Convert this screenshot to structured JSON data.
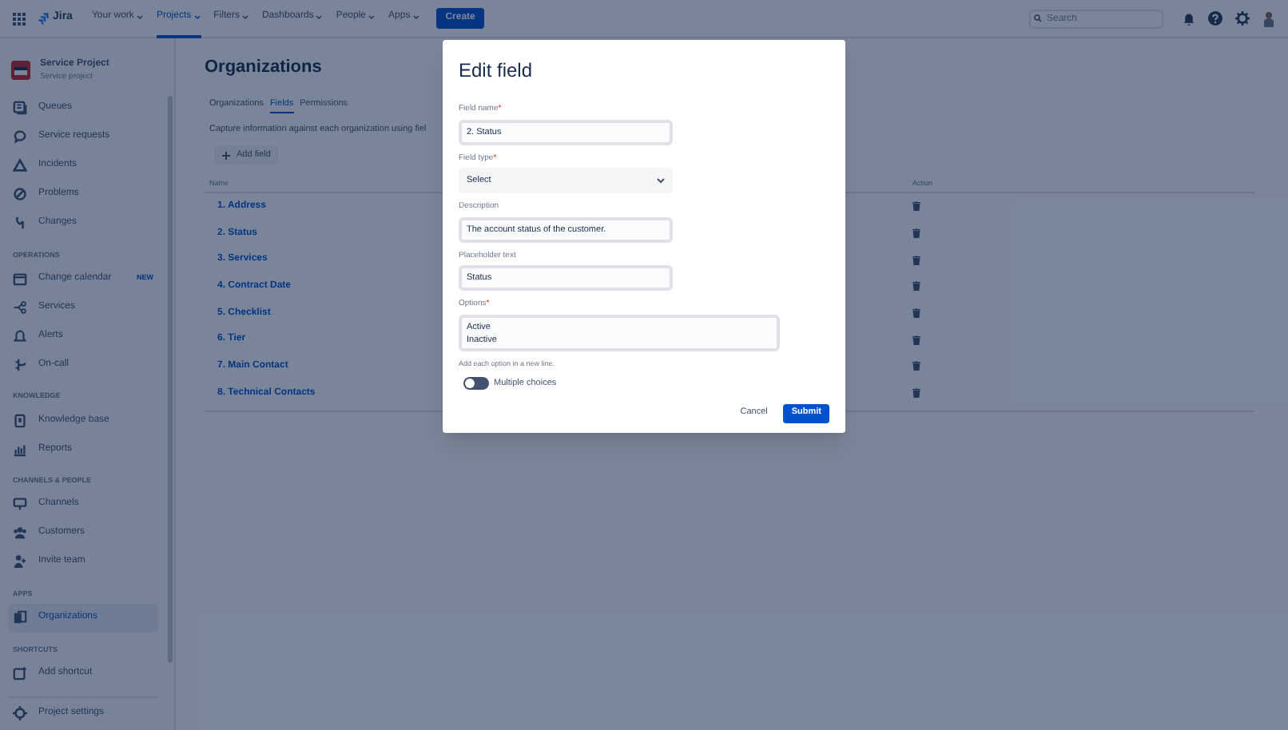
{
  "nav": {
    "logo": "Jira",
    "items": [
      {
        "label": "Your work",
        "selected": false
      },
      {
        "label": "Projects",
        "selected": true
      },
      {
        "label": "Filters",
        "selected": false
      },
      {
        "label": "Dashboards",
        "selected": false
      },
      {
        "label": "People",
        "selected": false
      },
      {
        "label": "Apps",
        "selected": false
      }
    ],
    "create": "Create",
    "search": {
      "placeholder": "Search"
    }
  },
  "sidebar": {
    "project": {
      "name": "Service Project",
      "type": "Service project"
    },
    "sections": [
      {
        "items": [
          {
            "label": "Queues",
            "selected": false
          },
          {
            "label": "Service requests",
            "selected": false
          },
          {
            "label": "Incidents",
            "selected": false
          },
          {
            "label": "Problems",
            "selected": false
          },
          {
            "label": "Changes",
            "selected": false
          }
        ]
      },
      {
        "heading": "OPERATIONS",
        "items": [
          {
            "label": "Change calendar",
            "badge": "NEW",
            "selected": false
          },
          {
            "label": "Services",
            "selected": false
          },
          {
            "label": "Alerts",
            "selected": false
          },
          {
            "label": "On-call",
            "selected": false
          }
        ]
      },
      {
        "heading": "KNOWLEDGE",
        "items": [
          {
            "label": "Knowledge base",
            "selected": false
          },
          {
            "label": "Reports",
            "selected": false
          }
        ]
      },
      {
        "heading": "CHANNELS & PEOPLE",
        "items": [
          {
            "label": "Channels",
            "selected": false
          },
          {
            "label": "Customers",
            "selected": false
          },
          {
            "label": "Invite team",
            "selected": false
          }
        ]
      },
      {
        "heading": "APPS",
        "items": [
          {
            "label": "Organizations",
            "selected": true
          }
        ]
      },
      {
        "heading": "SHORTCUTS",
        "items": [
          {
            "label": "Add shortcut",
            "selected": false
          }
        ]
      }
    ],
    "footer": "Project settings"
  },
  "main": {
    "title": "Organizations",
    "tabs": [
      {
        "label": "Organizations",
        "selected": false
      },
      {
        "label": "Fields",
        "selected": true
      },
      {
        "label": "Permissions",
        "selected": false
      }
    ],
    "description": "Capture information against each organization using fiel",
    "add_button": "Add field",
    "table": {
      "columns": [
        "Name",
        "Action"
      ],
      "rows": [
        "1. Address",
        "2. Status",
        "3. Services",
        "4. Contract Date",
        "5. Checklist",
        "6. Tier",
        "7. Main Contact",
        "8. Technical Contacts"
      ]
    }
  },
  "modal": {
    "title": "Edit field",
    "fields": [
      {
        "kind": "text",
        "label": "Field name",
        "required_mark": "*",
        "value": "2. Status"
      },
      {
        "kind": "select",
        "label": "Field type",
        "required_mark": "*",
        "value": "Select"
      },
      {
        "kind": "text",
        "label": "Description",
        "value": "The account status of the customer."
      },
      {
        "kind": "text",
        "label": "Placeholder text",
        "value": "Status"
      },
      {
        "kind": "textarea",
        "label": "Options",
        "required_mark": "*",
        "value": "Active\nInactive",
        "hint": "Add each option in a new line."
      }
    ],
    "toggle": {
      "label": "Multiple choices",
      "on": false
    },
    "cancel": "Cancel",
    "submit": "Submit"
  }
}
